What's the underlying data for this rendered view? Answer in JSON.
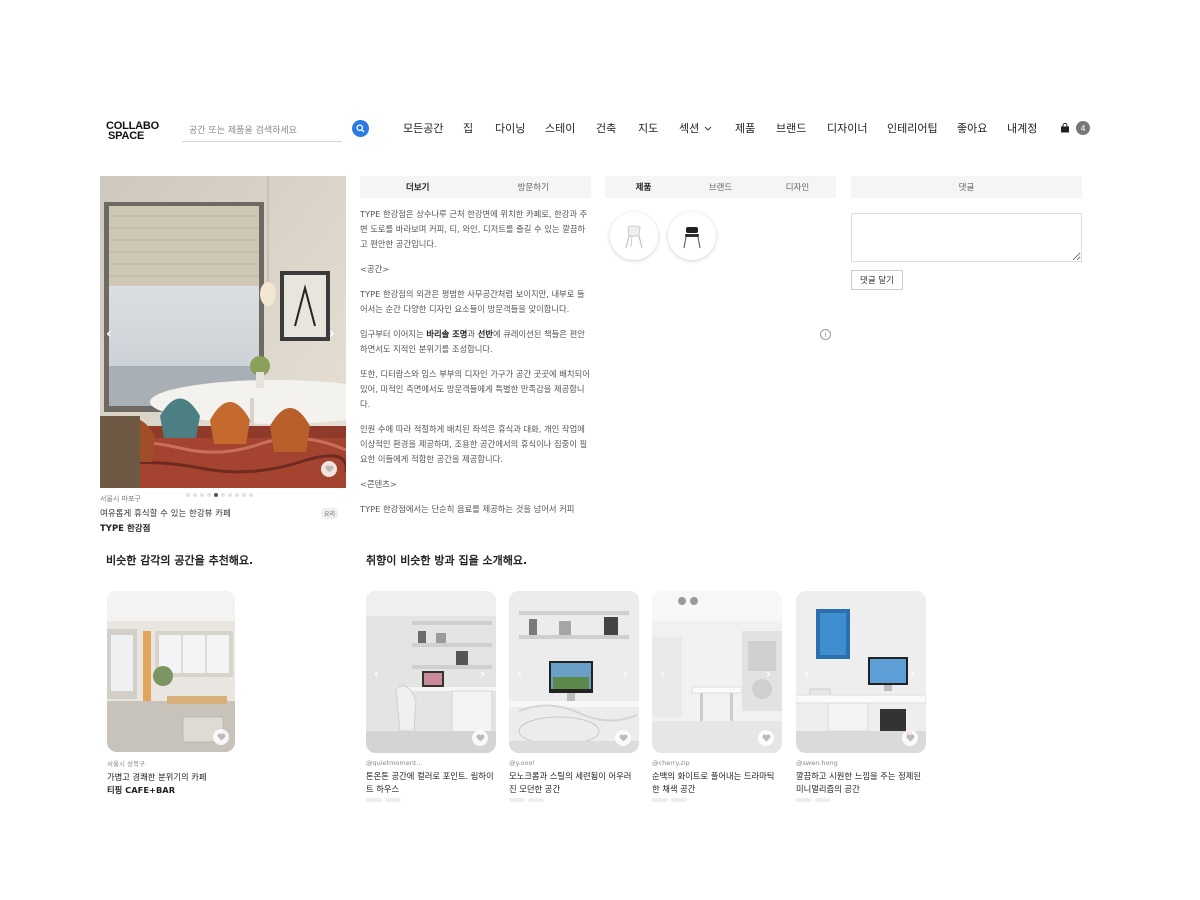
{
  "header": {
    "logo_line1": "COLLABO",
    "logo_line2": "SPACE",
    "search_placeholder": "공간 또는 제품을 검색하세요",
    "nav": [
      "모든공간",
      "집",
      "다이닝",
      "스테이",
      "건축",
      "지도",
      "섹션",
      "제품",
      "브랜드",
      "디자이너",
      "인테리어팁",
      "좋아요",
      "내계정"
    ],
    "cart_count": "4"
  },
  "hero": {
    "location": "서울시 마포구",
    "description": "여유롭게 휴식할 수 있는 한강뷰 카페",
    "name": "TYPE 한강점",
    "tag": "요리",
    "slide_count": 10,
    "active_slide": 4
  },
  "description_panel": {
    "tabs": [
      "더보기",
      "방문하기"
    ],
    "p1": "TYPE 한강점은 상수나루 근처 한강변에 위치한 카페로, 한강과 주변 도로를 바라보며 커피, 티, 와인, 디저트를 즐길 수 있는 깔끔하고 편안한 공간입니다.",
    "h1": "<공간>",
    "p2": "TYPE 한강점의 외관은 평범한 사무공간처럼 보이지만, 내부로 들어서는 순간 다양한 디자인 요소들이 방문객들을 맞이합니다.",
    "p3_a": "입구부터 이어지는 ",
    "p3_b1": "바리솔 조명",
    "p3_c": "과 ",
    "p3_b2": "선반",
    "p3_d": "에 큐레이션된 책들은 편안하면서도 지적인 분위기를 조성합니다.",
    "p4": "또한, 디터람스와 임스 부부의 디자인 가구가 공간 곳곳에 배치되어 있어, 미적인 측면에서도 방문객들에게 특별한 만족감을 제공합니다.",
    "p5": "인원 수에 따라 적절하게 배치된 좌석은 휴식과 대화, 개인 작업에 이상적인 환경을 제공하며, 조용한 공간에서의 휴식이나 집중이 필요한 이들에게 적합한 공간을 제공합니다.",
    "h2": "<콘텐츠>",
    "p6": "TYPE 한강점에서는 단순히 음료를 제공하는 것을 넘어서 커피"
  },
  "products_panel": {
    "tabs": [
      "제품",
      "브랜드",
      "디자인"
    ]
  },
  "comments_panel": {
    "tab": "댓글",
    "button": "댓글 달기"
  },
  "similar_spaces": {
    "title": "비슷한 감각의 공간을 추천해요.",
    "items": [
      {
        "location": "서울시 성북구",
        "description": "가볍고 경쾌한 분위기의 카페",
        "name": "티핑 CAFE+BAR"
      }
    ]
  },
  "similar_rooms": {
    "title": "취향이 비슷한 방과 집을 소개해요.",
    "items": [
      {
        "author": "@quietmoment...",
        "title": "톤온톤 공간에 컬러로 포인트. 림하이트 하우스"
      },
      {
        "author": "@y.ooo!",
        "title": "모노크롬과 스틸의 세련됨이 어우러진 모던한 공간"
      },
      {
        "author": "@cherry.zip",
        "title": "순백의 화이트로 풀어내는 드라마틱한 채색 공간"
      },
      {
        "author": "@swen.hong",
        "title": "깔끔하고 시원한 느낌을 주는 정제된 미니멀리즘의 공간"
      }
    ]
  },
  "colors": {
    "accent": "#2a7be4",
    "tab_bg": "#f5f5f5"
  }
}
